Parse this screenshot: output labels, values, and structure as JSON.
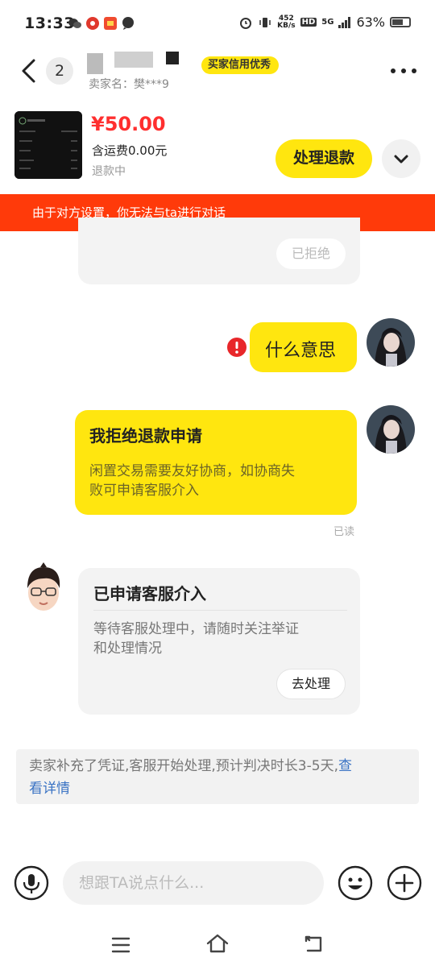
{
  "status_bar": {
    "time": "13:33",
    "net_speed_value": "452",
    "net_speed_unit": "KB/s",
    "hd_label": "HD",
    "network": "5G",
    "battery": "63%"
  },
  "header": {
    "back_count": "2",
    "seller_prefix": "卖家名：",
    "seller_masked": "樊***9",
    "credit_tag": "买家信用优秀",
    "more_icon": "more-horizontal-icon"
  },
  "product": {
    "price": "¥50.00",
    "shipping": "含运费0.00元",
    "status": "退款中",
    "refund_button": "处理退款"
  },
  "warning": {
    "text": "由于对方设置，你无法与ta进行对话",
    "color": "#ff3a0a"
  },
  "chat": {
    "rejected_pill": "已拒绝",
    "msg1_text": "什么意思",
    "msg2_title": "我拒绝退款申请",
    "msg2_body_line1": "闲置交易需要友好协商，如协商失",
    "msg2_body_line2": "败可申请客服介入",
    "read_label": "已读",
    "cs_title": "已申请客服介入",
    "cs_body_line1": "等待客服处理中，请随时关注举证",
    "cs_body_line2": "和处理情况",
    "cs_button": "去处理",
    "notice_text": "卖家补充了凭证,客服开始处理,预计判决时长3-5天,",
    "notice_link_1": "查",
    "notice_link_2": "看详情"
  },
  "input": {
    "placeholder": "想跟TA说点什么..."
  },
  "colors": {
    "accent": "#ffe60f",
    "price": "#ff2f2f",
    "link": "#3a73c4"
  }
}
